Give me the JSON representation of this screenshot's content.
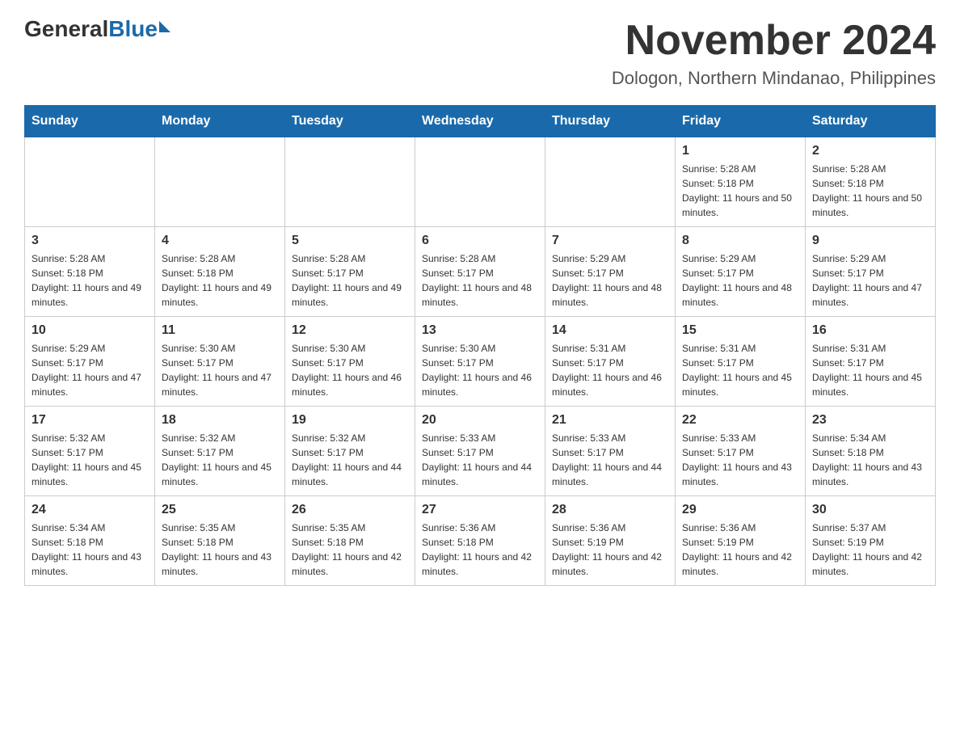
{
  "logo": {
    "general": "General",
    "blue": "Blue"
  },
  "header": {
    "title": "November 2024",
    "subtitle": "Dologon, Northern Mindanao, Philippines"
  },
  "days_of_week": [
    "Sunday",
    "Monday",
    "Tuesday",
    "Wednesday",
    "Thursday",
    "Friday",
    "Saturday"
  ],
  "weeks": [
    [
      {
        "day": "",
        "sunrise": "",
        "sunset": "",
        "daylight": ""
      },
      {
        "day": "",
        "sunrise": "",
        "sunset": "",
        "daylight": ""
      },
      {
        "day": "",
        "sunrise": "",
        "sunset": "",
        "daylight": ""
      },
      {
        "day": "",
        "sunrise": "",
        "sunset": "",
        "daylight": ""
      },
      {
        "day": "",
        "sunrise": "",
        "sunset": "",
        "daylight": ""
      },
      {
        "day": "1",
        "sunrise": "Sunrise: 5:28 AM",
        "sunset": "Sunset: 5:18 PM",
        "daylight": "Daylight: 11 hours and 50 minutes."
      },
      {
        "day": "2",
        "sunrise": "Sunrise: 5:28 AM",
        "sunset": "Sunset: 5:18 PM",
        "daylight": "Daylight: 11 hours and 50 minutes."
      }
    ],
    [
      {
        "day": "3",
        "sunrise": "Sunrise: 5:28 AM",
        "sunset": "Sunset: 5:18 PM",
        "daylight": "Daylight: 11 hours and 49 minutes."
      },
      {
        "day": "4",
        "sunrise": "Sunrise: 5:28 AM",
        "sunset": "Sunset: 5:18 PM",
        "daylight": "Daylight: 11 hours and 49 minutes."
      },
      {
        "day": "5",
        "sunrise": "Sunrise: 5:28 AM",
        "sunset": "Sunset: 5:17 PM",
        "daylight": "Daylight: 11 hours and 49 minutes."
      },
      {
        "day": "6",
        "sunrise": "Sunrise: 5:28 AM",
        "sunset": "Sunset: 5:17 PM",
        "daylight": "Daylight: 11 hours and 48 minutes."
      },
      {
        "day": "7",
        "sunrise": "Sunrise: 5:29 AM",
        "sunset": "Sunset: 5:17 PM",
        "daylight": "Daylight: 11 hours and 48 minutes."
      },
      {
        "day": "8",
        "sunrise": "Sunrise: 5:29 AM",
        "sunset": "Sunset: 5:17 PM",
        "daylight": "Daylight: 11 hours and 48 minutes."
      },
      {
        "day": "9",
        "sunrise": "Sunrise: 5:29 AM",
        "sunset": "Sunset: 5:17 PM",
        "daylight": "Daylight: 11 hours and 47 minutes."
      }
    ],
    [
      {
        "day": "10",
        "sunrise": "Sunrise: 5:29 AM",
        "sunset": "Sunset: 5:17 PM",
        "daylight": "Daylight: 11 hours and 47 minutes."
      },
      {
        "day": "11",
        "sunrise": "Sunrise: 5:30 AM",
        "sunset": "Sunset: 5:17 PM",
        "daylight": "Daylight: 11 hours and 47 minutes."
      },
      {
        "day": "12",
        "sunrise": "Sunrise: 5:30 AM",
        "sunset": "Sunset: 5:17 PM",
        "daylight": "Daylight: 11 hours and 46 minutes."
      },
      {
        "day": "13",
        "sunrise": "Sunrise: 5:30 AM",
        "sunset": "Sunset: 5:17 PM",
        "daylight": "Daylight: 11 hours and 46 minutes."
      },
      {
        "day": "14",
        "sunrise": "Sunrise: 5:31 AM",
        "sunset": "Sunset: 5:17 PM",
        "daylight": "Daylight: 11 hours and 46 minutes."
      },
      {
        "day": "15",
        "sunrise": "Sunrise: 5:31 AM",
        "sunset": "Sunset: 5:17 PM",
        "daylight": "Daylight: 11 hours and 45 minutes."
      },
      {
        "day": "16",
        "sunrise": "Sunrise: 5:31 AM",
        "sunset": "Sunset: 5:17 PM",
        "daylight": "Daylight: 11 hours and 45 minutes."
      }
    ],
    [
      {
        "day": "17",
        "sunrise": "Sunrise: 5:32 AM",
        "sunset": "Sunset: 5:17 PM",
        "daylight": "Daylight: 11 hours and 45 minutes."
      },
      {
        "day": "18",
        "sunrise": "Sunrise: 5:32 AM",
        "sunset": "Sunset: 5:17 PM",
        "daylight": "Daylight: 11 hours and 45 minutes."
      },
      {
        "day": "19",
        "sunrise": "Sunrise: 5:32 AM",
        "sunset": "Sunset: 5:17 PM",
        "daylight": "Daylight: 11 hours and 44 minutes."
      },
      {
        "day": "20",
        "sunrise": "Sunrise: 5:33 AM",
        "sunset": "Sunset: 5:17 PM",
        "daylight": "Daylight: 11 hours and 44 minutes."
      },
      {
        "day": "21",
        "sunrise": "Sunrise: 5:33 AM",
        "sunset": "Sunset: 5:17 PM",
        "daylight": "Daylight: 11 hours and 44 minutes."
      },
      {
        "day": "22",
        "sunrise": "Sunrise: 5:33 AM",
        "sunset": "Sunset: 5:17 PM",
        "daylight": "Daylight: 11 hours and 43 minutes."
      },
      {
        "day": "23",
        "sunrise": "Sunrise: 5:34 AM",
        "sunset": "Sunset: 5:18 PM",
        "daylight": "Daylight: 11 hours and 43 minutes."
      }
    ],
    [
      {
        "day": "24",
        "sunrise": "Sunrise: 5:34 AM",
        "sunset": "Sunset: 5:18 PM",
        "daylight": "Daylight: 11 hours and 43 minutes."
      },
      {
        "day": "25",
        "sunrise": "Sunrise: 5:35 AM",
        "sunset": "Sunset: 5:18 PM",
        "daylight": "Daylight: 11 hours and 43 minutes."
      },
      {
        "day": "26",
        "sunrise": "Sunrise: 5:35 AM",
        "sunset": "Sunset: 5:18 PM",
        "daylight": "Daylight: 11 hours and 42 minutes."
      },
      {
        "day": "27",
        "sunrise": "Sunrise: 5:36 AM",
        "sunset": "Sunset: 5:18 PM",
        "daylight": "Daylight: 11 hours and 42 minutes."
      },
      {
        "day": "28",
        "sunrise": "Sunrise: 5:36 AM",
        "sunset": "Sunset: 5:19 PM",
        "daylight": "Daylight: 11 hours and 42 minutes."
      },
      {
        "day": "29",
        "sunrise": "Sunrise: 5:36 AM",
        "sunset": "Sunset: 5:19 PM",
        "daylight": "Daylight: 11 hours and 42 minutes."
      },
      {
        "day": "30",
        "sunrise": "Sunrise: 5:37 AM",
        "sunset": "Sunset: 5:19 PM",
        "daylight": "Daylight: 11 hours and 42 minutes."
      }
    ]
  ]
}
